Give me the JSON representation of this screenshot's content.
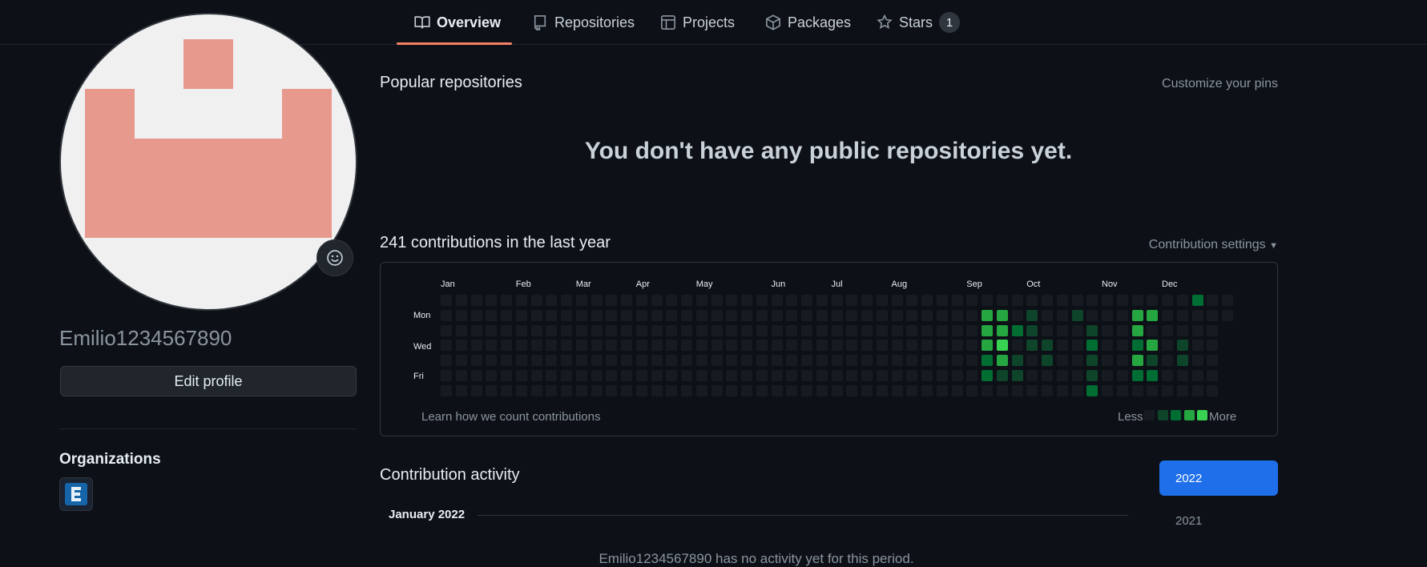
{
  "tabs": [
    {
      "label": "Overview",
      "icon": "book-icon",
      "active": true
    },
    {
      "label": "Repositories",
      "icon": "repo-icon"
    },
    {
      "label": "Projects",
      "icon": "table-icon"
    },
    {
      "label": "Packages",
      "icon": "package-icon"
    },
    {
      "label": "Stars",
      "icon": "star-icon",
      "count": "1"
    }
  ],
  "profile": {
    "username": "Emilio1234567890",
    "edit_label": "Edit profile",
    "status_icon": "smiley-icon",
    "orgs_title": "Organizations",
    "org_avatar_letter": "E"
  },
  "popular": {
    "title": "Popular repositories",
    "customize_label": "Customize your pins",
    "empty_message": "You don't have any public repositories yet."
  },
  "contributions": {
    "title": "241 contributions in the last year",
    "settings_label": "Contribution settings",
    "months": [
      "Jan",
      "Feb",
      "Mar",
      "Apr",
      "May",
      "Jun",
      "Jul",
      "Aug",
      "Sep",
      "Oct",
      "Nov",
      "Dec"
    ],
    "days": [
      "Mon",
      "Wed",
      "Fri"
    ],
    "learn_link": "Learn how we count contributions",
    "legend_less": "Less",
    "legend_more": "More",
    "level_colors": [
      "#161b22",
      "#0e4429",
      "#006d32",
      "#26a641",
      "#39d353"
    ],
    "active_cells": [
      {
        "week": 36,
        "day": 1,
        "level": 3
      },
      {
        "week": 36,
        "day": 2,
        "level": 3
      },
      {
        "week": 36,
        "day": 3,
        "level": 3
      },
      {
        "week": 36,
        "day": 4,
        "level": 2
      },
      {
        "week": 36,
        "day": 5,
        "level": 2
      },
      {
        "week": 37,
        "day": 1,
        "level": 3
      },
      {
        "week": 37,
        "day": 2,
        "level": 3
      },
      {
        "week": 37,
        "day": 3,
        "level": 4
      },
      {
        "week": 37,
        "day": 4,
        "level": 3
      },
      {
        "week": 37,
        "day": 5,
        "level": 1
      },
      {
        "week": 38,
        "day": 2,
        "level": 2
      },
      {
        "week": 38,
        "day": 4,
        "level": 1
      },
      {
        "week": 38,
        "day": 5,
        "level": 1
      },
      {
        "week": 39,
        "day": 1,
        "level": 1
      },
      {
        "week": 39,
        "day": 2,
        "level": 1
      },
      {
        "week": 39,
        "day": 3,
        "level": 1
      },
      {
        "week": 40,
        "day": 3,
        "level": 1
      },
      {
        "week": 40,
        "day": 4,
        "level": 1
      },
      {
        "week": 42,
        "day": 1,
        "level": 1
      },
      {
        "week": 43,
        "day": 2,
        "level": 1
      },
      {
        "week": 43,
        "day": 3,
        "level": 2
      },
      {
        "week": 43,
        "day": 4,
        "level": 1
      },
      {
        "week": 43,
        "day": 5,
        "level": 1
      },
      {
        "week": 43,
        "day": 6,
        "level": 2
      },
      {
        "week": 46,
        "day": 1,
        "level": 3
      },
      {
        "week": 46,
        "day": 2,
        "level": 3
      },
      {
        "week": 46,
        "day": 3,
        "level": 2
      },
      {
        "week": 46,
        "day": 4,
        "level": 3
      },
      {
        "week": 46,
        "day": 5,
        "level": 2
      },
      {
        "week": 47,
        "day": 1,
        "level": 3
      },
      {
        "week": 47,
        "day": 3,
        "level": 3
      },
      {
        "week": 47,
        "day": 4,
        "level": 1
      },
      {
        "week": 47,
        "day": 5,
        "level": 2
      },
      {
        "week": 49,
        "day": 3,
        "level": 1
      },
      {
        "week": 49,
        "day": 4,
        "level": 1
      },
      {
        "week": 50,
        "day": 0,
        "level": 2
      }
    ]
  },
  "activity": {
    "title": "Contribution activity",
    "month_heading": "January 2022",
    "empty_message": "Emilio1234567890 has no activity yet for this period.",
    "years": [
      "2022",
      "2021"
    ],
    "selected_year": "2022"
  },
  "colors": {
    "background": "#0d1117",
    "accent": "#1f6feb",
    "tab_underline": "#f78166",
    "avatar_pink": "#e8998d"
  }
}
